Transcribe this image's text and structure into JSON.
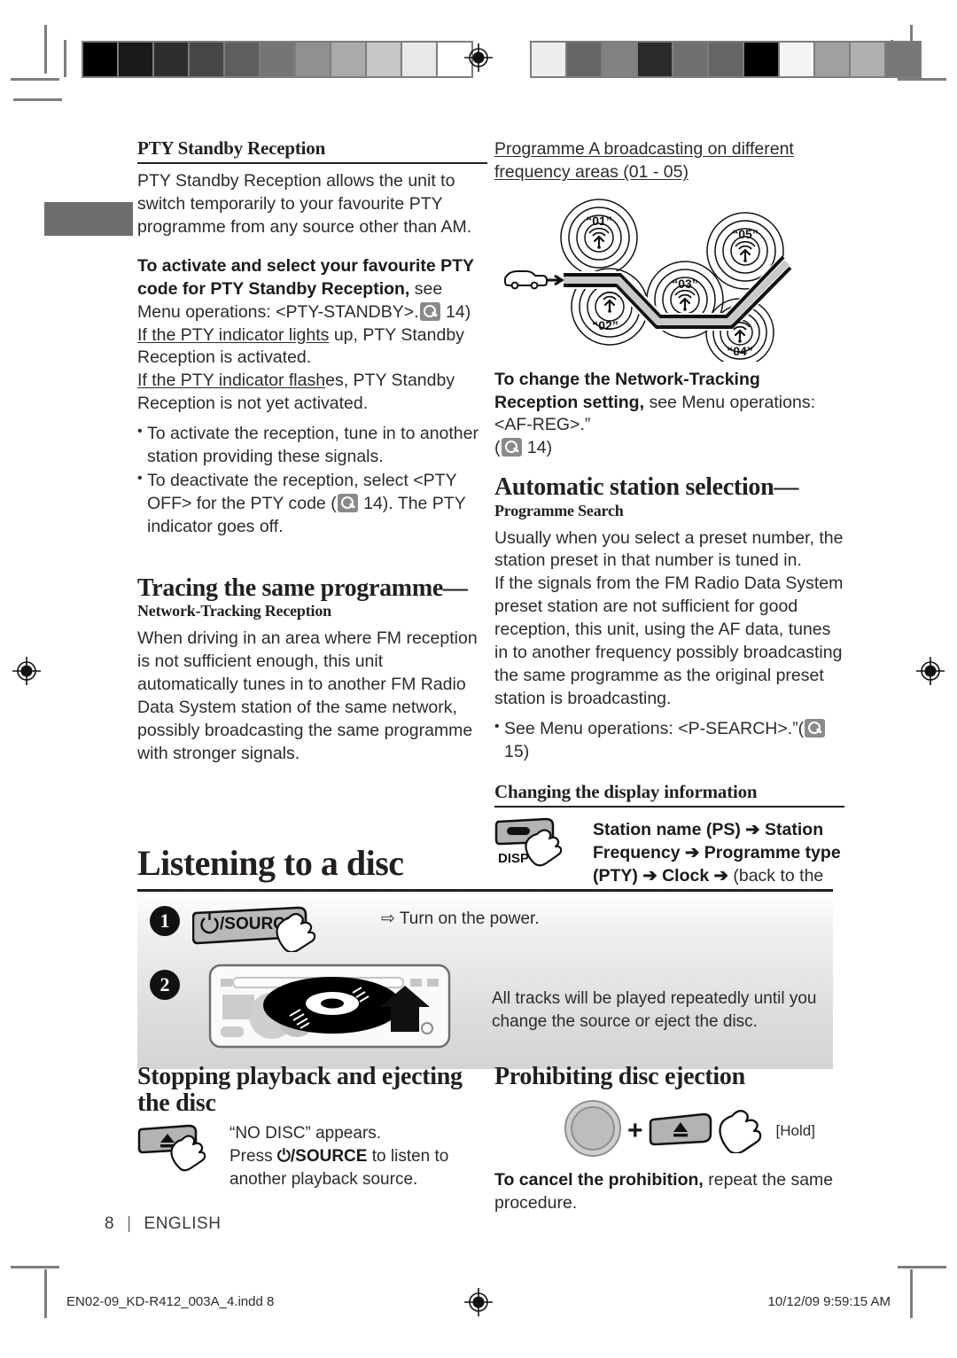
{
  "print_marks": {
    "calibration_left": [
      "#000000",
      "#1a1a1a",
      "#2e2e2e",
      "#474747",
      "#5e5e5e",
      "#757575",
      "#909090",
      "#aaaaaa",
      "#c6c6c6",
      "#e8e8e8",
      "#ffffff"
    ],
    "calibration_right": [
      "#eeeeee",
      "#666666",
      "#828282",
      "#2a2a2a",
      "#707070",
      "#666666",
      "#000000",
      "#f5f5f5",
      "#a0a0a0",
      "#b0b0b0",
      "#777777"
    ],
    "registration_icon": "registration-target-icon"
  },
  "left_column": {
    "pty_standby": {
      "heading": "PTY Standby Reception",
      "intro": "PTY Standby Reception allows the unit to switch temporarily to your favourite PTY programme from any source other than AM.",
      "activate_bold": "To activate and select your favourite PTY code for PTY Standby Reception,",
      "activate_rest": " see Menu operations: <PTY-STANDBY>.",
      "activate_page": "14)",
      "lights_underline": "If the PTY indicator lights",
      "lights_rest": " up, PTY Standby Reception is activated.",
      "flashes_underline": "If the PTY indicator flash",
      "flashes_rest": "es, PTY Standby Reception is not yet activated.",
      "bullets": [
        {
          "pre": "To activate the reception, tune in to another station providing these signals.",
          "page": "",
          "post": ""
        },
        {
          "pre": "To deactivate the reception, select <PTY OFF> for the PTY code (",
          "page": "14)",
          "post": ". The PTY indicator goes off."
        }
      ]
    },
    "tracing": {
      "heading": "Tracing the same programme—",
      "subheading": "Network-Tracking Reception",
      "body": "When driving in an area where FM reception is not sufficient enough, this unit automatically tunes in to another FM Radio Data System station of the same network, possibly broadcasting the same programme with stronger signals."
    }
  },
  "right_column": {
    "diagram": {
      "caption": "Programme A broadcasting on different frequency areas (01 - 05)",
      "station_labels": [
        "“01”",
        "“02”",
        "“03”",
        "“04”",
        "“05”"
      ],
      "car_icon": "car-icon",
      "antenna_icon": "antenna-icon"
    },
    "change_setting_bold": "To change the Network-Tracking Reception setting,",
    "change_setting_rest": " see Menu operations: <AF-REG>.”",
    "change_setting_page": "14)",
    "auto_station": {
      "heading": "Automatic station selection—",
      "subheading": "Programme Search",
      "body1": "Usually when you select a preset number, the station preset in that number is tuned in.",
      "body2": "If the signals from the FM Radio Data System preset station are not sufficient for good reception, this unit, using the AF data, tunes in to another frequency possibly broadcasting the same programme as the original preset station is broadcasting.",
      "bullet_pre": "See Menu operations: <P-SEARCH>.”(",
      "bullet_page": "15)"
    },
    "display_info": {
      "heading": "Changing the display information",
      "button_label": "DISP",
      "button_icon": "disp-button-icon",
      "hand_icon": "pointing-hand-icon",
      "sequence_bold": "Station name (PS) ➔ Station Frequency ➔ Programme type (PTY) ➔ Clock ➔",
      "sequence_thin": " (back to the beginning)"
    }
  },
  "disc_section": {
    "title": "Listening to a disc",
    "steps": [
      {
        "number": "1",
        "button_label": "/SOURCE",
        "power_icon": "power-icon",
        "hand_icon": "pointing-hand-icon",
        "caption": "⇨ Turn on the power."
      },
      {
        "number": "2",
        "unit_icon": "disc-slot-icon",
        "caption": "All tracks will be played repeatedly until you change the source or eject the disc."
      }
    ]
  },
  "bottom_left": {
    "heading": "Stopping playback and ejecting the disc",
    "button_icon": "eject-button-icon",
    "hand_icon": "pointing-hand-icon",
    "line1": "“NO DISC” appears.",
    "line2_pre": "Press ",
    "line2_bold": "⏻/SOURCE",
    "line2_post": " to listen to another playback source."
  },
  "bottom_right": {
    "heading": "Prohibiting disc ejection",
    "knob_icon": "volume-knob-icon",
    "eject_icon": "eject-button-icon",
    "hand_icon": "pointing-hand-icon",
    "plus": "+",
    "hold_label": "[Hold]",
    "cancel_bold": "To cancel the prohibition,",
    "cancel_rest": " repeat the same procedure."
  },
  "footer": {
    "page_number": "8",
    "separator": "|",
    "language": "ENGLISH",
    "file_name": "EN02-09_KD-R412_003A_4.indd   8",
    "timestamp": "10/12/09   9:59:15 AM"
  }
}
